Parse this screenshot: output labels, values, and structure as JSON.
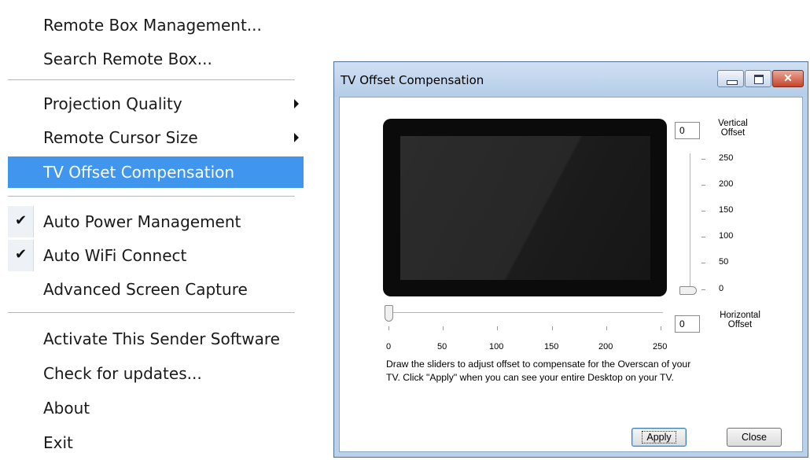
{
  "menu": {
    "items": [
      {
        "label": "Remote Box Management..."
      },
      {
        "label": "Search Remote Box..."
      },
      {
        "label": "Projection Quality"
      },
      {
        "label": "Remote Cursor Size"
      },
      {
        "label": "TV Offset Compensation"
      },
      {
        "label": "Auto Power Management"
      },
      {
        "label": "Auto WiFi Connect"
      },
      {
        "label": "Advanced Screen Capture"
      },
      {
        "label": "Activate This Sender Software"
      },
      {
        "label": "Check for updates..."
      },
      {
        "label": "About"
      },
      {
        "label": "Exit"
      }
    ],
    "highlight_color": "#3f96ec"
  },
  "dialog": {
    "title": "TV Offset Compensation",
    "vertical": {
      "value": "0",
      "caption_line1": "Vertical",
      "caption_line2": "Offset",
      "ticks": [
        "250",
        "200",
        "150",
        "100",
        "50",
        "0"
      ]
    },
    "horizontal": {
      "value": "0",
      "caption_line1": "Horizontal",
      "caption_line2": "Offset",
      "ticks": [
        "0",
        "50",
        "100",
        "150",
        "200",
        "250"
      ]
    },
    "instructions_line1": "Draw the sliders to adjust offset to compensate for the Overscan of your",
    "instructions_line2": "TV. Click \"Apply\" when you can see your entire Desktop on your TV.",
    "apply_label": "Apply",
    "close_label": "Close"
  }
}
